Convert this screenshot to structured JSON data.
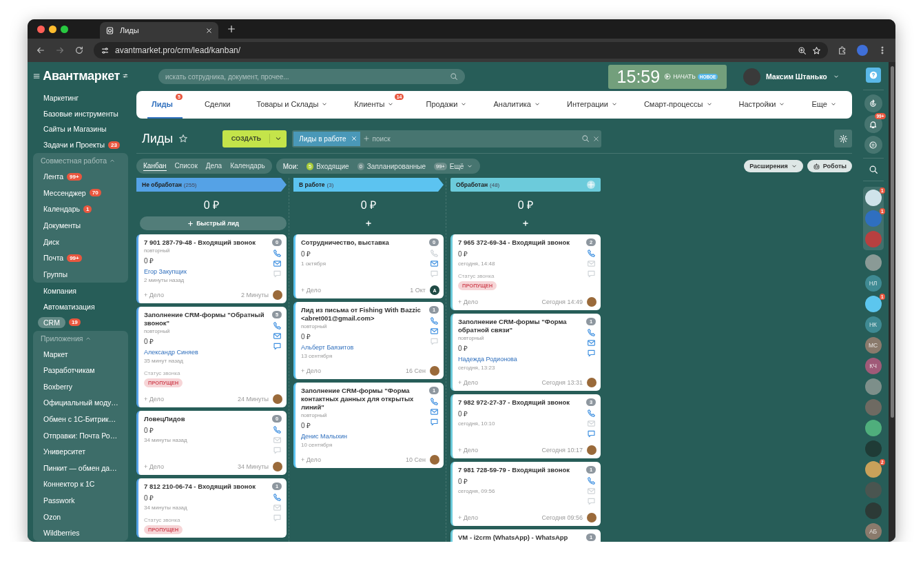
{
  "browser": {
    "tab_title": "Лиды",
    "url": "avantmarket.pro/crm/lead/kanban/"
  },
  "logo": "Авантмаркет",
  "sidebar": {
    "items": [
      {
        "kind": "item",
        "label": "Маркетинг",
        "selected": false
      },
      {
        "kind": "item",
        "label": "Базовые инструменты",
        "selected": false
      },
      {
        "kind": "item",
        "label": "Сайты и Магазины",
        "selected": false
      },
      {
        "kind": "item",
        "label": "Задачи и Проекты",
        "badge": "23",
        "selected": false
      },
      {
        "kind": "group",
        "label": "Совместная работа",
        "expanded": true,
        "children": [
          {
            "kind": "item",
            "label": "Лента",
            "badge": "99+",
            "selected": false
          },
          {
            "kind": "item",
            "label": "Мессенджер",
            "badge": "70",
            "selected": false
          },
          {
            "kind": "item",
            "label": "Календарь",
            "badge": "1",
            "selected": false
          },
          {
            "kind": "item",
            "label": "Документы",
            "selected": false
          },
          {
            "kind": "item",
            "label": "Диск",
            "selected": false
          },
          {
            "kind": "item",
            "label": "Почта",
            "badge": "99+",
            "selected": false
          },
          {
            "kind": "item",
            "label": "Группы",
            "selected": false
          }
        ]
      },
      {
        "kind": "item",
        "label": "Компания",
        "selected": false
      },
      {
        "kind": "item",
        "label": "Автоматизация",
        "selected": false
      },
      {
        "kind": "item",
        "label": "CRM",
        "badge": "19",
        "selected": true
      },
      {
        "kind": "group",
        "label": "Приложения",
        "expanded": true,
        "children": [
          {
            "kind": "item",
            "label": "Маркет",
            "selected": false
          },
          {
            "kind": "item",
            "label": "Разработчикам",
            "selected": false
          },
          {
            "kind": "item",
            "label": "Boxberry",
            "selected": false
          },
          {
            "kind": "item",
            "label": "Официальный моду…",
            "selected": false
          },
          {
            "kind": "item",
            "label": "Обмен с 1С-Битрик…",
            "selected": false
          },
          {
            "kind": "item",
            "label": "Отправки: Почта Ро…",
            "selected": false
          },
          {
            "kind": "item",
            "label": "Университет",
            "selected": false
          },
          {
            "kind": "item",
            "label": "Пинкит — обмен да…",
            "selected": false
          },
          {
            "kind": "item",
            "label": "Коннектор к 1С",
            "selected": false
          },
          {
            "kind": "item",
            "label": "Passwork",
            "selected": false
          },
          {
            "kind": "item",
            "label": "Ozon",
            "selected": false
          },
          {
            "kind": "item",
            "label": "Wildberries",
            "selected": false
          }
        ]
      }
    ]
  },
  "header": {
    "search_placeholder": "искать сотрудника, документ, прочее...",
    "clock": "15:59",
    "start_label": "НАЧАТЬ",
    "new_badge": "НОВОЕ",
    "user": "Максим Штанько"
  },
  "nav": {
    "tabs": [
      {
        "label": "Лиды",
        "badge": "5",
        "has_menu": false,
        "selected": true
      },
      {
        "label": "Сделки",
        "has_menu": false,
        "selected": false
      },
      {
        "label": "Товары и Склады",
        "has_menu": true,
        "selected": false
      },
      {
        "label": "Клиенты",
        "badge": "14",
        "has_menu": true,
        "selected": false
      },
      {
        "label": "Продажи",
        "has_menu": true,
        "selected": false
      },
      {
        "label": "Аналитика",
        "has_menu": true,
        "selected": false
      },
      {
        "label": "Интеграции",
        "has_menu": true,
        "selected": false
      },
      {
        "label": "Смарт-процессы",
        "has_menu": true,
        "selected": false
      },
      {
        "label": "Настройки",
        "has_menu": true,
        "selected": false
      },
      {
        "label": "Еще",
        "has_menu": true,
        "selected": false
      }
    ]
  },
  "toolbar": {
    "title": "Лиды",
    "create_label": "СОЗДАТЬ",
    "filter_chip": "Лиды в работе",
    "search_placeholder": "поиск"
  },
  "views": [
    {
      "label": "Канбан",
      "selected": true
    },
    {
      "label": "Список",
      "selected": false
    },
    {
      "label": "Дела",
      "selected": false
    },
    {
      "label": "Календарь",
      "selected": false
    }
  ],
  "counters": {
    "label": "Мои:",
    "items": [
      {
        "count": "5",
        "label": "Входящие",
        "color": "#a9cc3a"
      },
      {
        "count": "0",
        "label": "Запланированные",
        "color": "#6f8f8c"
      },
      {
        "count": "99+",
        "label": "Ещё",
        "color": "#6f8f8c"
      }
    ]
  },
  "extensions_label": "Расширения",
  "robots_label": "Роботы",
  "columns": [
    {
      "title": "Не обработан",
      "count": "(255)",
      "color": "#55a2e6",
      "total": "0 ₽",
      "add_label": "Быстрый лид",
      "cards": [
        {
          "title": "7 901 287-79-48 - Входящий звонок",
          "counter": "0",
          "repeat": "повторный",
          "amount": "0 ₽",
          "contact": "Егор Закупщик",
          "time": "2 минуты назад",
          "activity": "+ Дело",
          "date": "2 Минуты",
          "phone": true,
          "mail": true,
          "chat": false
        },
        {
          "title": "Заполнение CRM-формы \"Обратный звонок\"",
          "counter": "5",
          "repeat": "повторный",
          "amount": "0 ₽",
          "contact": "Александр Синяев",
          "time": "35 минут назад",
          "status_label": "Статус звонка",
          "status": "ПРОПУЩЕН",
          "activity": "+ Дело",
          "date": "24 Минуты",
          "phone": true,
          "mail": true,
          "chat": true
        },
        {
          "title": "ЛовецЛидов",
          "counter": "0",
          "amount": "0 ₽",
          "time": "34 минуты назад",
          "activity": "+ Дело",
          "date": "34 Минуты",
          "phone": true,
          "mail": false,
          "chat": false
        },
        {
          "title": "7 812 210-06-74 - Входящий звонок",
          "counter": "1",
          "amount": "0 ₽",
          "time": "34 минуты назад",
          "status_label": "Статус звонка",
          "status": "ПРОПУЩЕН",
          "phone": true,
          "mail": false,
          "chat": false
        }
      ]
    },
    {
      "title": "В работе",
      "count": "(3)",
      "color": "#5cc3f0",
      "total": "0 ₽",
      "cards": [
        {
          "title": "Сотрудничество, выставка",
          "counter": "0",
          "amount": "0 ₽",
          "time": "1 октября",
          "activity": "+ Дело",
          "date": "1 Окт",
          "avatar_initial": "A",
          "phone": false,
          "mail": true,
          "chat": false
        },
        {
          "title": "Лид из письма от Fishing With Bazzic <abret001@gmail.com>",
          "counter": "1",
          "repeat": "повторный",
          "amount": "0 ₽",
          "contact": "Альберт Баязитов",
          "time": "13 сентября",
          "activity": "+ Дело",
          "date": "16 Сен",
          "phone": true,
          "mail": true,
          "chat": false
        },
        {
          "title": "Заполнение CRM-формы \"Форма контактных данных для открытых линий\"",
          "counter": "1",
          "repeat": "повторный",
          "amount": "0 ₽",
          "contact": "Денис Малыхин",
          "time": "10 сентября",
          "activity": "+ Дело",
          "date": "10 Сен",
          "phone": true,
          "mail": true,
          "chat": true
        }
      ]
    },
    {
      "title": "Обработан",
      "count": "(48)",
      "color": "#6ccbdb",
      "total": "0 ₽",
      "cards": [
        {
          "title": "7 965 372-69-34 - Входящий звонок",
          "counter": "2",
          "amount": "0 ₽",
          "time": "сегодня, 14:48",
          "status_label": "Статус звонка",
          "status": "ПРОПУЩЕН",
          "activity": "+ Дело",
          "date": "Сегодня 14:49",
          "phone": true,
          "mail": false,
          "chat": false
        },
        {
          "title": "Заполнение CRM-формы \"Форма обратной связи\"",
          "counter": "1",
          "repeat": "повторный",
          "amount": "0 ₽",
          "contact": "Надежда Родионова",
          "time": "сегодня, 13:23",
          "activity": "+ Дело",
          "date": "Сегодня 13:31",
          "phone": true,
          "mail": true,
          "chat": true
        },
        {
          "title": "7 982 972-27-37 - Входящий звонок",
          "counter": "3",
          "amount": "0 ₽",
          "time": "сегодня, 10:10",
          "activity": "+ Дело",
          "date": "Сегодня 10:17",
          "phone": true,
          "mail": false,
          "chat": true
        },
        {
          "title": "7 981 728-59-79 - Входящий звонок",
          "counter": "1",
          "amount": "0 ₽",
          "time": "сегодня, 09:56",
          "activity": "+ Дело",
          "date": "Сегодня 09:56",
          "phone": true,
          "mail": false,
          "chat": false
        },
        {
          "title": "VM - i2crm (WhatsApp) - WhatsApp",
          "counter": "1"
        }
      ]
    }
  ],
  "right_bar": {
    "notifications_badge": "99+",
    "pinned": [
      {
        "kind": "app",
        "color": "#cfe3ea",
        "badge": "1"
      },
      {
        "kind": "app",
        "color": "#2f6fc0",
        "badge": "1"
      },
      {
        "kind": "app",
        "color": "#b84040"
      }
    ],
    "contacts": [
      {
        "kind": "photo",
        "color": "#8a9a96"
      },
      {
        "kind": "initials",
        "initials": "НЛ",
        "color": "#3f8a93"
      },
      {
        "kind": "app",
        "color": "#5cc6ee",
        "badge": "1"
      },
      {
        "kind": "initials",
        "initials": "НК",
        "color": "#3f8a93"
      },
      {
        "kind": "initials",
        "initials": "МС",
        "color": "#8a7a6c"
      },
      {
        "kind": "initials",
        "initials": "КЧ",
        "color": "#a05a78"
      },
      {
        "kind": "photo",
        "color": "#7d8f8a"
      },
      {
        "kind": "photo",
        "color": "#6e6a62"
      },
      {
        "kind": "app",
        "color": "#4fae7c"
      },
      {
        "kind": "photo",
        "color": "#1f3b36"
      },
      {
        "kind": "photo",
        "color": "#c9a15a",
        "badge": "2"
      },
      {
        "kind": "photo",
        "color": "#4a5550"
      },
      {
        "kind": "photo",
        "color": "#2c3a36"
      },
      {
        "kind": "initials",
        "initials": "АБ",
        "color": "#8a7a6c"
      }
    ]
  }
}
